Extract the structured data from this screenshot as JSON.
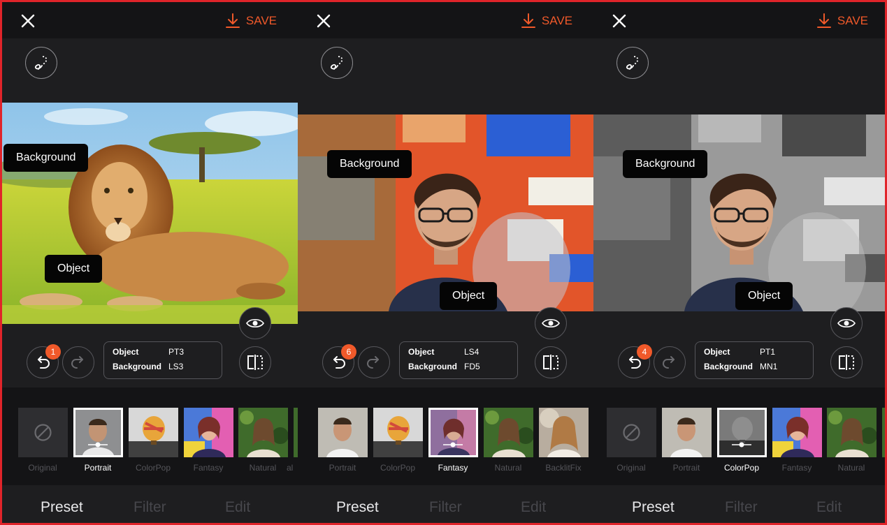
{
  "colors": {
    "accent": "#f0592a",
    "border": "#e0242a",
    "muted": "#55555a"
  },
  "panels": [
    {
      "save_label": "SAVE",
      "tag_background": "Background",
      "tag_object": "Object",
      "undo_count": "1",
      "info": {
        "object_key": "Object",
        "object_val": "PT3",
        "background_key": "Background",
        "background_val": "LS3"
      },
      "thumbs": [
        "Original",
        "Portrait",
        "ColorPop",
        "Fantasy",
        "Natural",
        "al"
      ],
      "selected": "Portrait",
      "tabs": [
        "Preset",
        "Filter",
        "Edit"
      ]
    },
    {
      "save_label": "SAVE",
      "tag_background": "Background",
      "tag_object": "Object",
      "undo_count": "6",
      "info": {
        "object_key": "Object",
        "object_val": "LS4",
        "background_key": "Background",
        "background_val": "FD5"
      },
      "thumbs": [
        "Portrait",
        "ColorPop",
        "Fantasy",
        "Natural",
        "BacklitFix"
      ],
      "selected": "Fantasy",
      "tabs": [
        "Preset",
        "Filter",
        "Edit"
      ]
    },
    {
      "save_label": "SAVE",
      "tag_background": "Background",
      "tag_object": "Object",
      "undo_count": "4",
      "info": {
        "object_key": "Object",
        "object_val": "PT1",
        "background_key": "Background",
        "background_val": "MN1"
      },
      "thumbs": [
        "Original",
        "Portrait",
        "ColorPop",
        "Fantasy",
        "Natural"
      ],
      "selected": "ColorPop",
      "tabs": [
        "Preset",
        "Filter",
        "Edit"
      ]
    }
  ]
}
